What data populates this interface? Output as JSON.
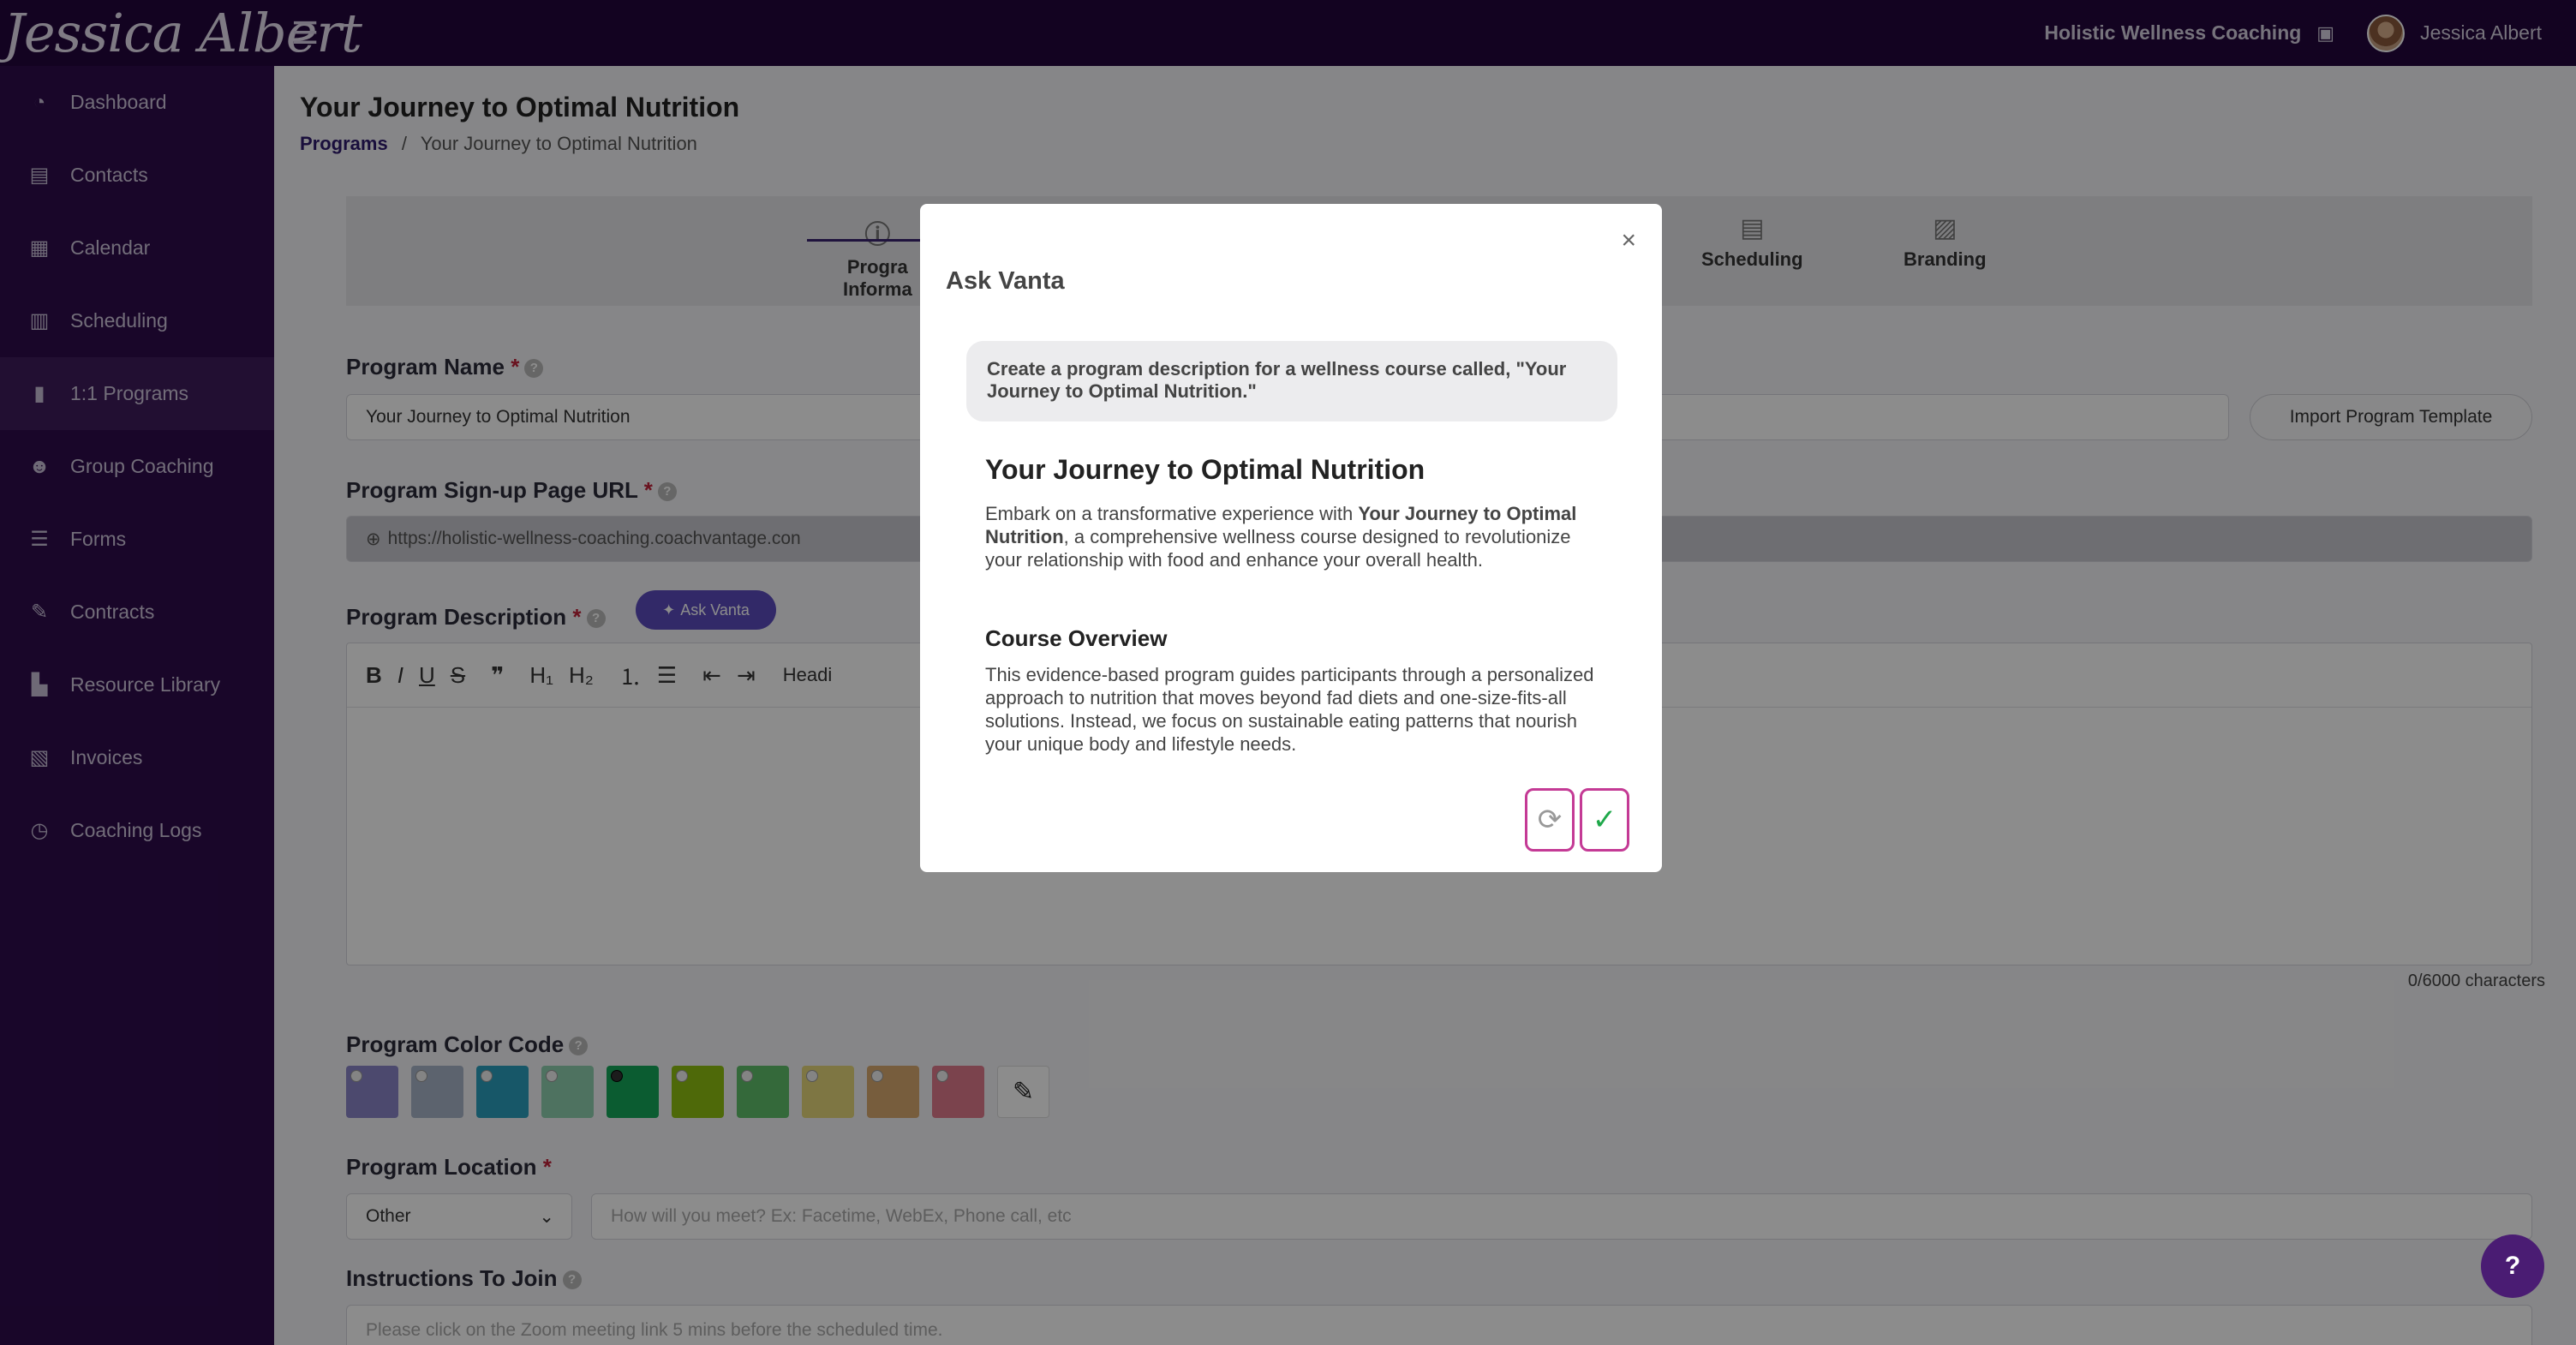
{
  "header": {
    "logo_text": "Jessica Albert",
    "org_name": "Holistic Wellness Coaching",
    "user_name": "Jessica Albert"
  },
  "sidebar": {
    "items": [
      {
        "label": "Dashboard",
        "icon": "dashboard-icon"
      },
      {
        "label": "Contacts",
        "icon": "contacts-icon"
      },
      {
        "label": "Calendar",
        "icon": "calendar-icon"
      },
      {
        "label": "Scheduling",
        "icon": "scheduling-icon"
      },
      {
        "label": "1:1 Programs",
        "icon": "book-icon"
      },
      {
        "label": "Group Coaching",
        "icon": "group-icon"
      },
      {
        "label": "Forms",
        "icon": "forms-icon"
      },
      {
        "label": "Contracts",
        "icon": "contract-icon"
      },
      {
        "label": "Resource Library",
        "icon": "library-icon"
      },
      {
        "label": "Invoices",
        "icon": "invoice-icon"
      },
      {
        "label": "Coaching Logs",
        "icon": "clock-icon"
      }
    ]
  },
  "page": {
    "title": "Your Journey to Optimal Nutrition",
    "breadcrumb_root": "Programs",
    "breadcrumb_sep": "/",
    "breadcrumb_current": "Your Journey to Optimal Nutrition"
  },
  "tabs": {
    "program_info_line1": "Progra",
    "program_info_line2": "Informa",
    "scheduling": "Scheduling",
    "branding": "Branding"
  },
  "form": {
    "program_name_label": "Program Name",
    "program_name_value": "Your Journey to Optimal Nutrition",
    "import_template": "Import Program Template",
    "signup_url_label": "Program Sign-up Page URL",
    "signup_url_value": "https://holistic-wellness-coaching.coachvantage.con",
    "description_label": "Program Description",
    "ask_vanta": "Ask Vanta",
    "heading_dropdown": "Headi",
    "char_count": "0/6000 characters",
    "color_code_label": "Program Color Code",
    "location_label": "Program Location",
    "location_value": "Other",
    "location_placeholder": "How will you meet? Ex: Facetime, WebEx, Phone call, etc",
    "instructions_label": "Instructions To Join",
    "instructions_placeholder": "Please click on the Zoom meeting link 5 mins before the scheduled time."
  },
  "colors": {
    "swatches": [
      "#8a86c8",
      "#a8b4c8",
      "#2a9fbd",
      "#8fcfb0",
      "#14a85a",
      "#8fbf12",
      "#5fbf6a",
      "#e6d77a",
      "#d9aa6f",
      "#e07a8c"
    ],
    "selected_index": 4
  },
  "modal": {
    "title": "Ask Vanta",
    "prompt": "Create a program description for a wellness course called, \"Your Journey to Optimal Nutrition.\"",
    "response_title": "Your Journey to Optimal Nutrition",
    "p1_a": "Embark on a transformative experience with ",
    "p1_bold": "Your Journey to Optimal Nutrition",
    "p1_b": ", a comprehensive wellness course designed to revolutionize your relationship with food and enhance your overall health.",
    "section_title": "Course Overview",
    "p2": "This evidence-based program guides participants through a personalized approach to nutrition that moves beyond fad diets and one-size-fits-all solutions. Instead, we focus on sustainable eating patterns that nourish your unique body and lifestyle needs."
  },
  "help": {
    "label": "?"
  }
}
